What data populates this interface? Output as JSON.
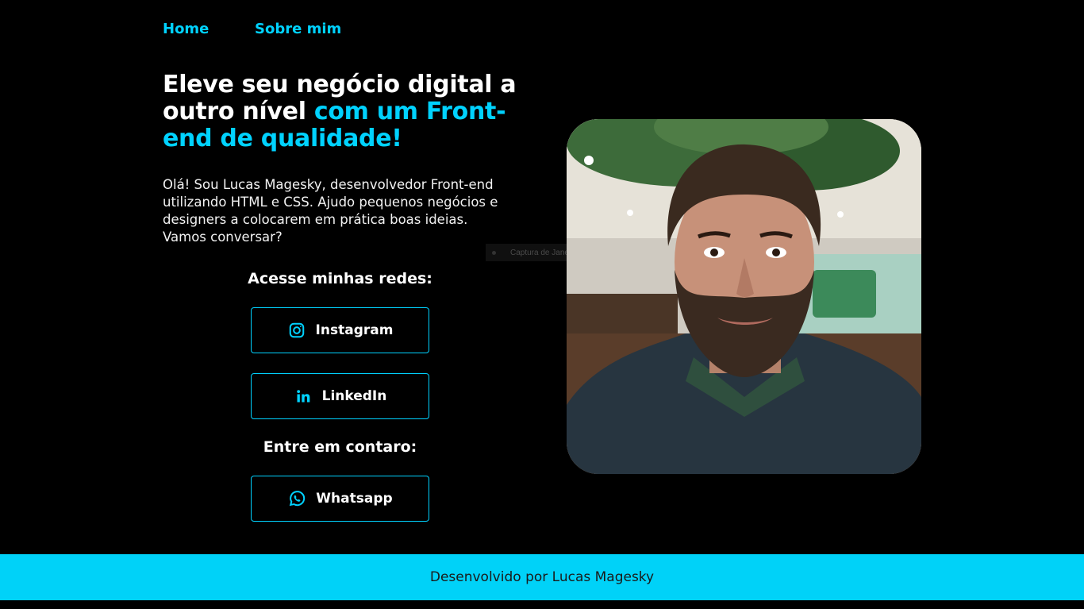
{
  "nav": {
    "items": [
      "Home",
      "Sobre mim"
    ]
  },
  "hero": {
    "headline_white": "Eleve seu negócio digital a outro nível",
    "headline_accent": "com um Front-end de qualidade!",
    "intro": "Olá! Sou Lucas Magesky, desenvolvedor Front-end utilizando HTML e CSS. Ajudo pequenos negócios e designers a colocarem em prática boas ideias. Vamos conversar?"
  },
  "social": {
    "title": "Acesse minhas redes:",
    "instagram_label": "Instagram",
    "linkedin_label": "LinkedIn"
  },
  "contact": {
    "title": "Entre em contaro:",
    "whatsapp_label": "Whatsapp"
  },
  "capture_tooltip": "Captura de Janela",
  "footer": {
    "text": "Desenvolvido por Lucas Magesky"
  },
  "colors": {
    "accent": "#00d2ff",
    "background": "#000000",
    "footer_bg": "#00d2f8"
  },
  "icons": [
    "instagram-icon",
    "linkedin-icon",
    "whatsapp-icon"
  ]
}
